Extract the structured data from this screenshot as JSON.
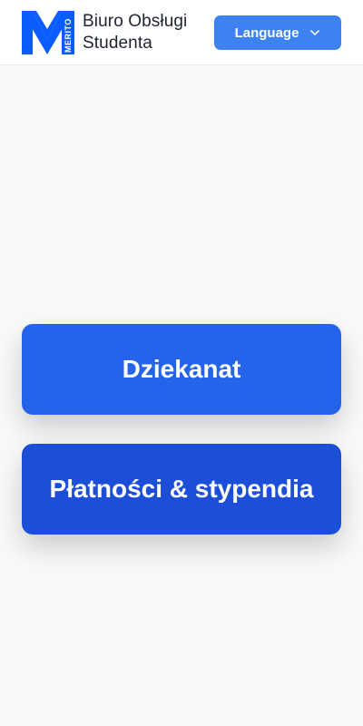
{
  "header": {
    "logo_text": "MERITO",
    "title_line1": "Biuro Obsługi",
    "title_line2": "Studenta",
    "language_button": {
      "label": "Language",
      "icon": "chevron-down-icon"
    }
  },
  "main": {
    "buttons": [
      {
        "label": "Dziekanat"
      },
      {
        "label": "Płatności & stypendia"
      }
    ]
  },
  "colors": {
    "background": "#f8f9fa",
    "header_background": "#ffffff",
    "brand_blue": "#0a5cff",
    "language_button": "#3d82f0",
    "dziekanat_button": "#2563eb",
    "platnosci_button": "#1d4ed8"
  }
}
